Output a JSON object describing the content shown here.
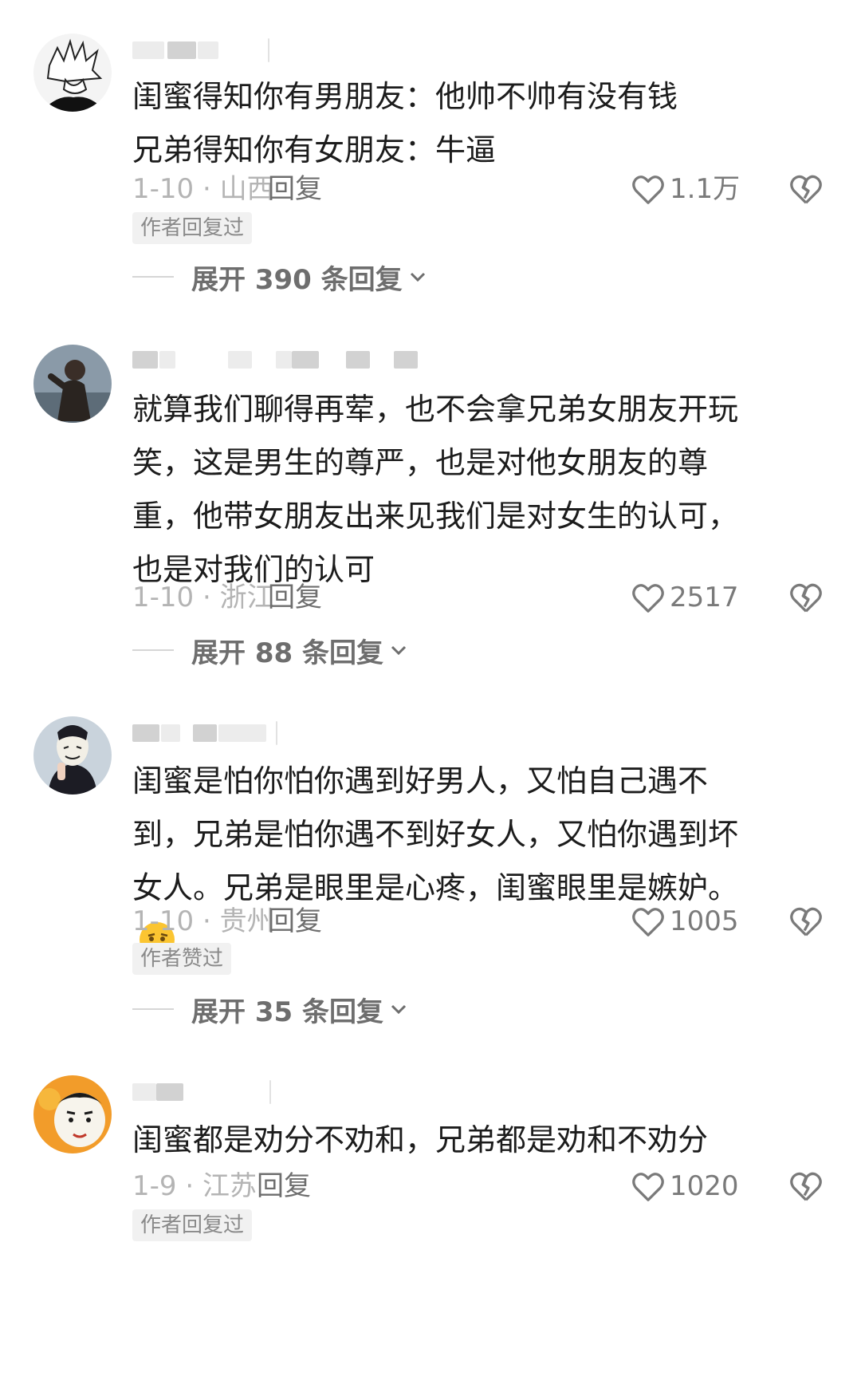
{
  "comments": [
    {
      "text": "闺蜜得知你有男朋友：他帅不帅有没有钱\n兄弟得知你有女朋友：牛逼",
      "date": "1-10 · 山西",
      "reply_label": "回复",
      "likes": "1.1万",
      "badge": "作者回复过",
      "expand": "展开 390 条回复",
      "avatar_icon": "anime-avatar-icon"
    },
    {
      "text": "就算我们聊得再荤，也不会拿兄弟女朋友开玩笑，这是男生的尊严，也是对他女朋友的尊重，他带女朋友出来见我们是对女生的认可，也是对我们的认可",
      "date": "1-10 · 浙江",
      "reply_label": "回复",
      "likes": "2517",
      "badge": "",
      "expand": "展开 88 条回复",
      "avatar_icon": "photo-avatar-icon"
    },
    {
      "text": "闺蜜是怕你怕你遇到好男人，又怕自己遇不到，兄弟是怕你遇不到好女人，又怕你遇到坏女人。兄弟是眼里是心疼，闺蜜眼里是嫉妒。",
      "emoji": "thinking-face-emoji",
      "date": "1-10 · 贵州",
      "reply_label": "回复",
      "likes": "1005",
      "badge": "作者赞过",
      "expand": "展开 35 条回复",
      "avatar_icon": "masked-person-avatar-icon"
    },
    {
      "text": "闺蜜都是劝分不劝和，兄弟都是劝和不劝分",
      "date": "1-9 · 江苏",
      "reply_label": "回复",
      "likes": "1020",
      "badge": "作者回复过",
      "expand": "",
      "avatar_icon": "cartoon-face-avatar-icon"
    }
  ],
  "colors": {
    "text": "#1c1c1c",
    "meta": "#b4b4b4",
    "action": "#6e6e6e",
    "badge_bg": "#f1f1f1"
  }
}
